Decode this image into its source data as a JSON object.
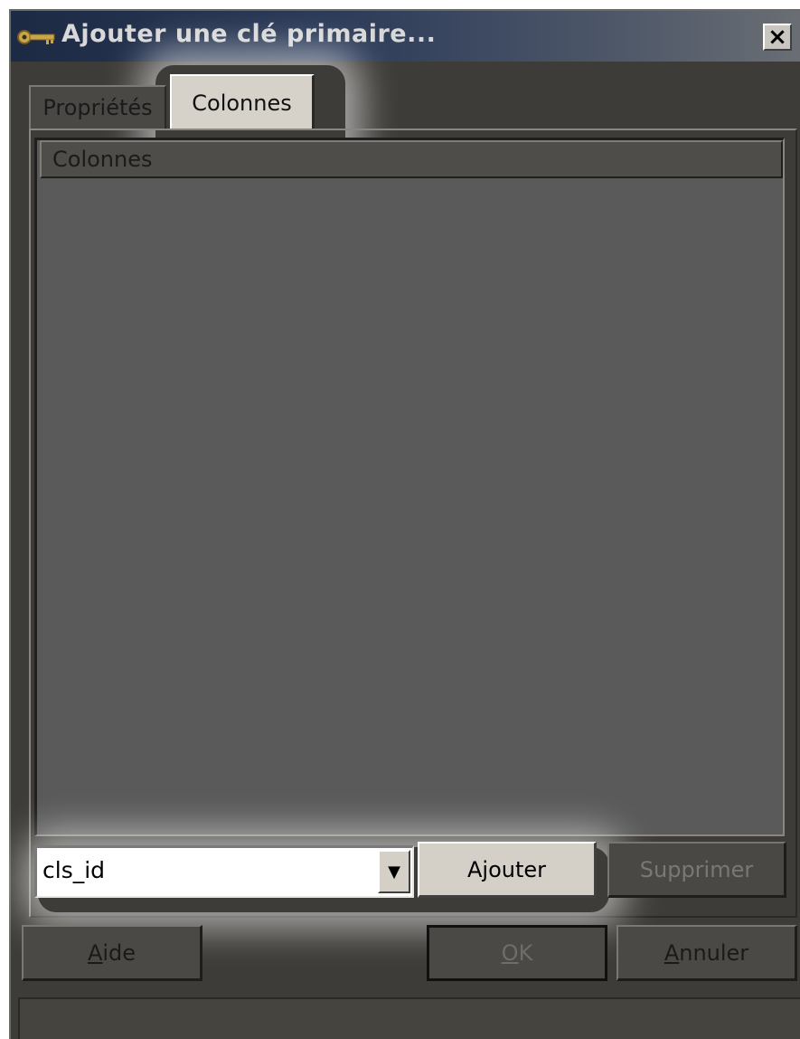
{
  "window": {
    "title": "Ajouter une clé primaire...",
    "icon": "key-icon",
    "close_glyph": "×"
  },
  "tabs": [
    {
      "label": "Propriétés",
      "selected": false
    },
    {
      "label": "Colonnes",
      "selected": true
    }
  ],
  "columns_list": {
    "header": "Colonnes",
    "rows": []
  },
  "column_select": {
    "value": "cls_id",
    "arrow_glyph": "▼"
  },
  "buttons": {
    "add": "Ajouter",
    "delete": "Supprimer",
    "help_mnemonic": "A",
    "help_rest": "ide",
    "ok_mnemonic": "O",
    "ok_rest": "K",
    "cancel_mnemonic": "A",
    "cancel_rest": "nnuler"
  },
  "status_text": "",
  "colors": {
    "dialog_bg": "#3e3c38",
    "title_bar": "#1d2a44",
    "active_tab": "#d6d2ca",
    "listbox_bg": "#5a5a5a",
    "highlight_glow": "#ffffff"
  }
}
